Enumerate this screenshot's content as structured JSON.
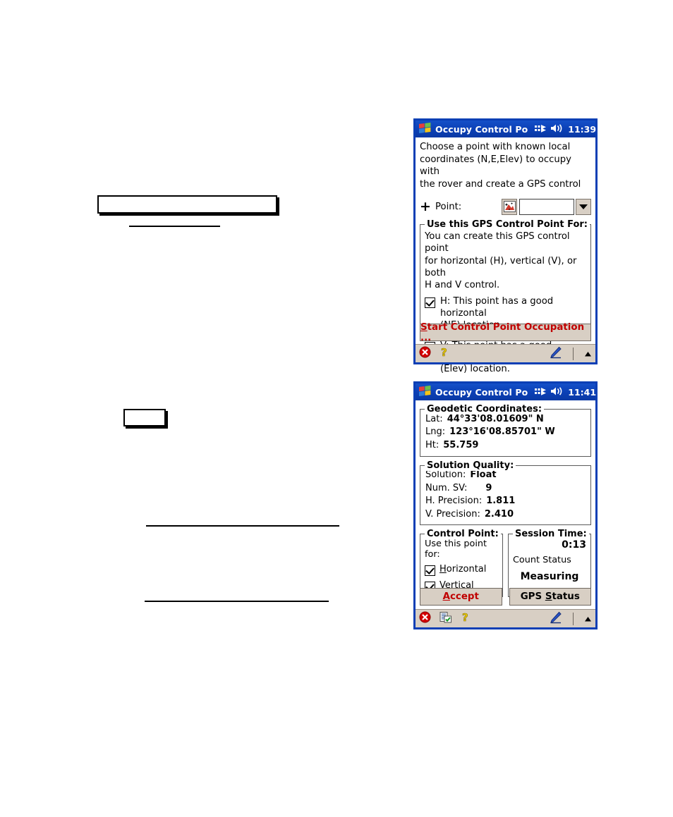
{
  "page": {
    "background": "#ffffff",
    "accent_blue": "#0b3fb5",
    "chrome_beige": "#d8cfc4",
    "action_red": "#c00000"
  },
  "document_artifacts": {
    "box_top": "",
    "rule_under_box": "",
    "box_middle": "",
    "rule_lower_upper": "",
    "rule_lower_lower": ""
  },
  "window1": {
    "title": "Occupy Control Po",
    "time": "11:39",
    "icons": {
      "start": "windows-flag-icon",
      "connectivity": "connectivity-icon",
      "volume": "speaker-icon"
    },
    "intro_text": "Choose a point with known local\ncoordinates (N,E,Elev) to occupy with\nthe rover and create a GPS control",
    "point_row": {
      "plus": "+",
      "label": "Point:",
      "picker_icon": "map-point-picker-icon",
      "input_value": "",
      "dropdown_icon": "chevron-down-icon"
    },
    "group": {
      "label": "Use this GPS Control Point For:",
      "description": "You can create this GPS control point\nfor horizontal (H), vertical (V), or both\nH and V control.",
      "checkboxes": [
        {
          "checked": true,
          "label": "H:  This point has a good horizontal\n(NE) location."
        },
        {
          "checked": true,
          "label": "V:  This point has a good vertical\n(Elev) location."
        }
      ]
    },
    "action_button": {
      "prefix": "S",
      "rest": "tart Control Point Occupation ...",
      "full": "Start Control Point Occupation ..."
    },
    "statusbar": {
      "close_icon": "close-red-circle-icon",
      "help_icon": "question-mark-help-icon",
      "pen_icon": "stylus-pen-icon",
      "up_icon": "caret-up-icon"
    }
  },
  "window2": {
    "title": "Occupy Control Po",
    "time": "11:41",
    "geodetic": {
      "label": "Geodetic Coordinates:",
      "rows": [
        {
          "key": "Lat:",
          "value": "44°33'08.01609\" N"
        },
        {
          "key": "Lng:",
          "value": "123°16'08.85701\" W"
        },
        {
          "key": "Ht:",
          "value": "55.759"
        }
      ]
    },
    "solution": {
      "label": "Solution Quality:",
      "rows": [
        {
          "key": "Solution:",
          "value": "Float"
        },
        {
          "key": "Num. SV:",
          "value": "9"
        },
        {
          "key": "H. Precision:",
          "value": "1.811"
        },
        {
          "key": "V. Precision:",
          "value": "2.410"
        }
      ]
    },
    "control_point": {
      "label": "Control Point:",
      "caption": "Use this point for:",
      "checkboxes": [
        {
          "checked": true,
          "prefix": "H",
          "rest": "orizontal",
          "full": "Horizontal"
        },
        {
          "checked": true,
          "prefix": "V",
          "rest": "ertical",
          "full": "Vertical"
        }
      ]
    },
    "session_time": {
      "label": "Session Time:",
      "elapsed": "0:13",
      "count_label": "Count Status",
      "status": "Measuring"
    },
    "buttons": [
      {
        "prefix": "A",
        "rest": "ccept",
        "full": "Accept",
        "color": "red"
      },
      {
        "prefix_before": "GPS ",
        "prefix": "S",
        "rest": "tatus",
        "full": "GPS Status",
        "color": "black"
      }
    ],
    "statusbar": {
      "close_icon": "close-red-circle-icon",
      "task_icon": "task-list-check-icon",
      "help_icon": "question-mark-help-icon",
      "pen_icon": "stylus-pen-icon",
      "up_icon": "caret-up-icon"
    }
  }
}
